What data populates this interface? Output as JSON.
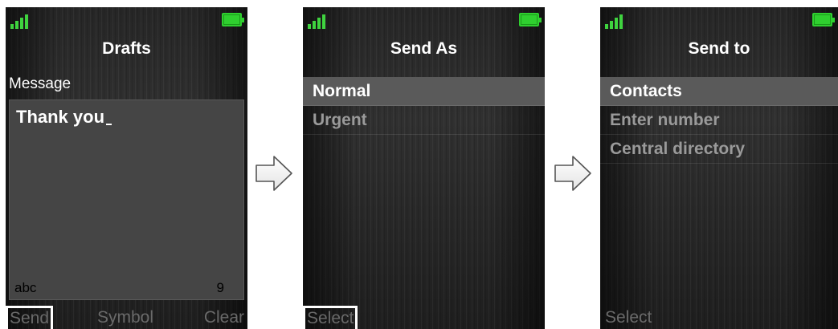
{
  "colors": {
    "signal": "#3fd33f",
    "battery": "#2fcf2f",
    "selected_row": "#5a5a5a",
    "text_box": "#454545"
  },
  "screen1": {
    "title": "Drafts",
    "message_label": "Message",
    "message_text": "Thank you",
    "input_mode": "abc",
    "char_count": "9",
    "softkeys": {
      "left": "Send",
      "center": "Symbol",
      "right": "Clear"
    }
  },
  "screen2": {
    "title": "Send As",
    "items": [
      {
        "label": "Normal",
        "selected": true
      },
      {
        "label": "Urgent",
        "selected": false
      }
    ],
    "softkeys": {
      "left": "Select"
    }
  },
  "screen3": {
    "title": "Send to",
    "items": [
      {
        "label": "Contacts",
        "selected": true
      },
      {
        "label": "Enter number",
        "selected": false
      },
      {
        "label": "Central directory",
        "selected": false
      }
    ],
    "softkeys": {
      "left": "Select"
    }
  },
  "icons": {
    "signal": "signal-strength-icon",
    "battery": "battery-icon",
    "arrow": "right-arrow-icon"
  }
}
